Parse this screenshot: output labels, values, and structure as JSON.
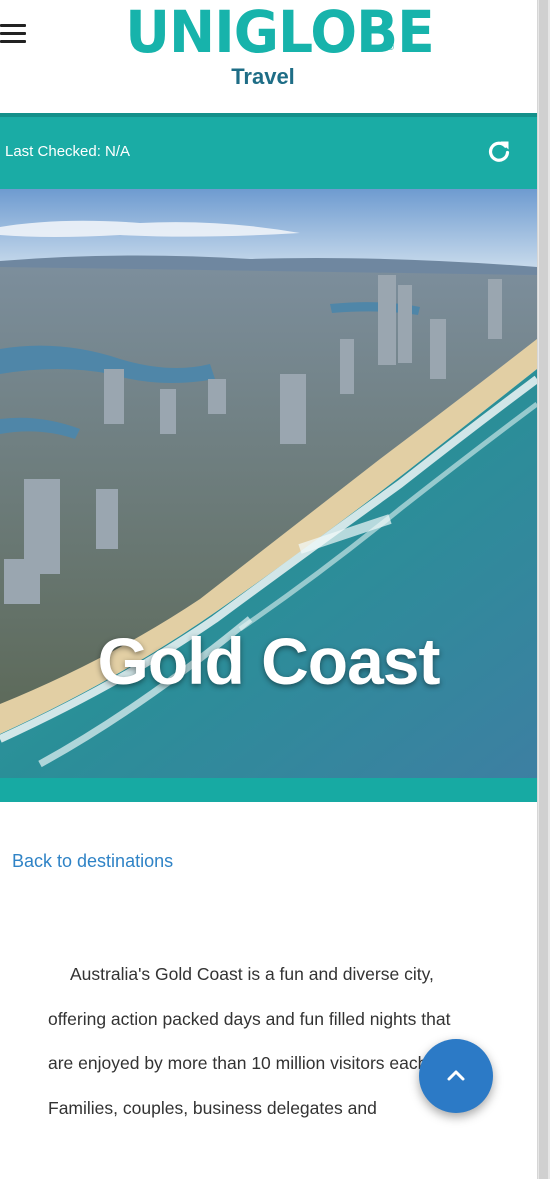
{
  "header": {
    "logo_text": "UNIGLOBE",
    "logo_reg": "®",
    "logo_subtitle": "Travel",
    "menu_icon": "hamburger-menu-icon"
  },
  "status": {
    "last_checked": "Last Checked: N/A",
    "refresh_icon": "refresh-icon"
  },
  "hero": {
    "title": "Gold Coast"
  },
  "nav": {
    "back_link": "Back to destinations"
  },
  "content": {
    "description": "Australia's Gold Coast is a fun and diverse city, offering action packed days and fun filled nights that are enjoyed by more than 10 million visitors each year. Families, couples, business delegates and"
  },
  "fab": {
    "icon": "chevron-up-icon"
  },
  "colors": {
    "brand_teal": "#1aaca5",
    "logo_teal": "#17b3ab",
    "logo_subtitle": "#1e6d86",
    "link_blue": "#2f83c6",
    "fab_blue": "#2c7ac6"
  }
}
